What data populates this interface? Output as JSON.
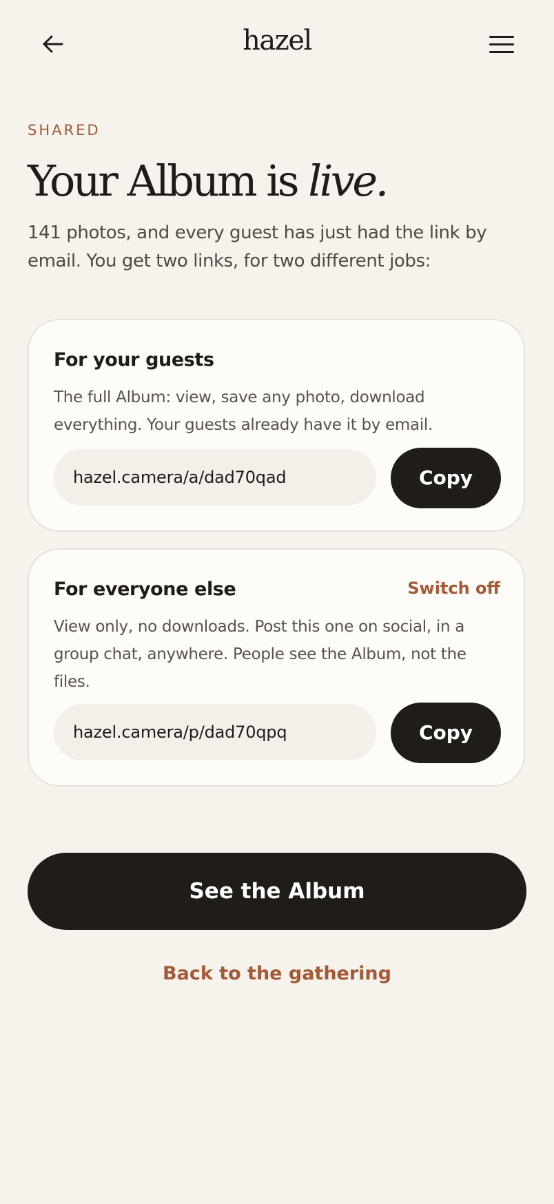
{
  "header": {
    "logo": "hazel",
    "back_icon": "arrow-left-icon",
    "menu_icon": "hamburger-menu-icon"
  },
  "eyebrow": "SHARED",
  "headline": {
    "prefix": "Your Album is ",
    "emphasis": "live."
  },
  "intro": "141 photos, and every guest has just had the link by email. You get two links, for two different jobs:",
  "cards": [
    {
      "title": "For your guests",
      "description": "The full Album: view, save any photo, download everything. Your guests already have it by email.",
      "link": "hazel.camera/a/dad70qad",
      "copy_label": "Copy"
    },
    {
      "title": "For everyone else",
      "action_label": "Switch off",
      "description": "View only, no downloads. Post this one on social, in a group chat, anywhere. People see the Album, not the files.",
      "link": "hazel.camera/p/dad70qpq",
      "copy_label": "Copy"
    }
  ],
  "primary_button": "See the Album",
  "secondary_link": "Back to the gathering",
  "colors": {
    "background": "#f6f2ec",
    "accent": "#a35a37",
    "dark": "#201c17",
    "card": "#fefcf8"
  }
}
